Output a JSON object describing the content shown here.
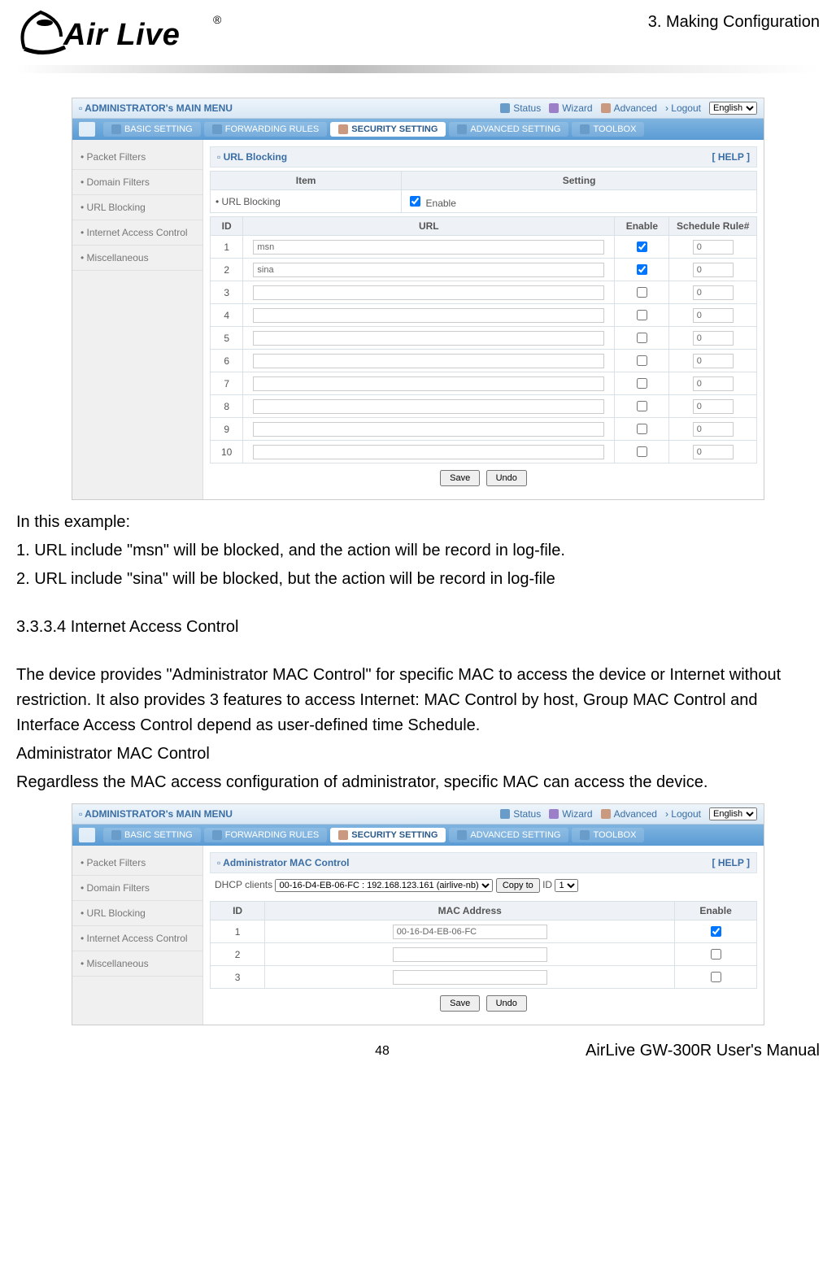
{
  "chapter": "3.  Making  Configuration",
  "logo_text": "Air Live",
  "logo_reg": "®",
  "example_heading": "In this example:",
  "example_line1": "1. URL include \"msn\" will be blocked, and the action will be record in log-file.",
  "example_line2": "2. URL include \"sina\" will be blocked, but the action will be record in log-file",
  "section_number": "3.3.3.4 Internet Access Control",
  "para1": "The device provides \"Administrator MAC Control\" for specific MAC to access the device or Internet without restriction. It also provides 3 features to access Internet: MAC Control by host, Group MAC Control and Interface Access Control depend as user-defined time Schedule.",
  "subhead": "Administrator MAC Control",
  "para2": "Regardless the MAC access configuration of administrator, specific MAC can access the device.",
  "page_number": "48",
  "manual_title": "AirLive GW-300R User's Manual",
  "router_common": {
    "main_menu": "ADMINISTRATOR's MAIN MENU",
    "status": "Status",
    "wizard": "Wizard",
    "advanced": "Advanced",
    "logout": "› Logout",
    "language": "English",
    "tabs": {
      "basic": "BASIC SETTING",
      "forwarding": "FORWARDING RULES",
      "security": "SECURITY SETTING",
      "advanced_setting": "ADVANCED SETTING",
      "toolbox": "TOOLBOX"
    },
    "sidebar": [
      "• Packet Filters",
      "• Domain Filters",
      "• URL Blocking",
      "• Internet Access Control",
      "• Miscellaneous"
    ],
    "help": "[ HELP ]",
    "save": "Save",
    "undo": "Undo"
  },
  "url_blocking": {
    "section_title": "URL Blocking",
    "item_header": "Item",
    "setting_header": "Setting",
    "item_label": "• URL Blocking",
    "enable_label": "Enable",
    "id_header": "ID",
    "url_header": "URL",
    "enable_header": "Enable",
    "schedule_header": "Schedule Rule#",
    "rows": [
      {
        "id": "1",
        "url": "msn",
        "enable": true,
        "rule": "0"
      },
      {
        "id": "2",
        "url": "sina",
        "enable": true,
        "rule": "0"
      },
      {
        "id": "3",
        "url": "",
        "enable": false,
        "rule": "0"
      },
      {
        "id": "4",
        "url": "",
        "enable": false,
        "rule": "0"
      },
      {
        "id": "5",
        "url": "",
        "enable": false,
        "rule": "0"
      },
      {
        "id": "6",
        "url": "",
        "enable": false,
        "rule": "0"
      },
      {
        "id": "7",
        "url": "",
        "enable": false,
        "rule": "0"
      },
      {
        "id": "8",
        "url": "",
        "enable": false,
        "rule": "0"
      },
      {
        "id": "9",
        "url": "",
        "enable": false,
        "rule": "0"
      },
      {
        "id": "10",
        "url": "",
        "enable": false,
        "rule": "0"
      }
    ]
  },
  "mac_control": {
    "section_title": "Administrator MAC Control",
    "dhcp_label": "DHCP clients",
    "dhcp_option": "00-16-D4-EB-06-FC : 192.168.123.161 (airlive-nb)",
    "copy_to": "Copy to",
    "id_label": "ID",
    "id_value": "1",
    "id_header": "ID",
    "mac_header": "MAC Address",
    "enable_header": "Enable",
    "rows": [
      {
        "id": "1",
        "mac": "00-16-D4-EB-06-FC",
        "enable": true
      },
      {
        "id": "2",
        "mac": "",
        "enable": false
      },
      {
        "id": "3",
        "mac": "",
        "enable": false
      }
    ]
  }
}
